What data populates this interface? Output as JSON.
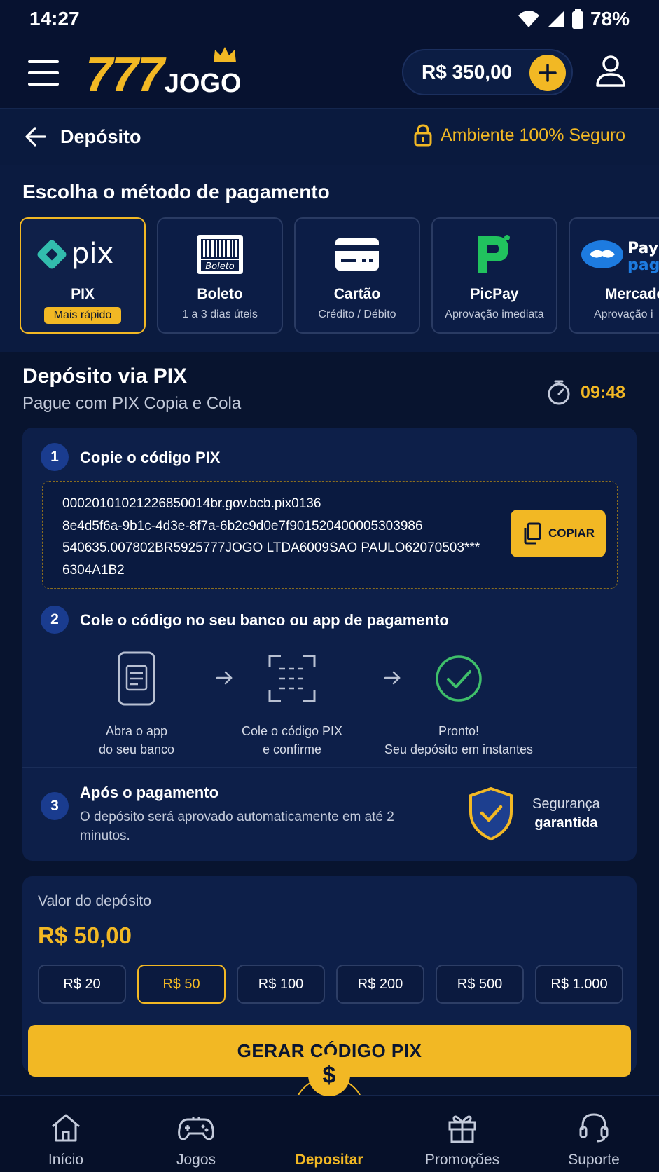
{
  "status_bar": {
    "time": "14:27",
    "battery": "78%"
  },
  "header": {
    "logo_number": "777",
    "logo_text": "JOGO",
    "balance": "R$ 350,00"
  },
  "subheader": {
    "title": "Depósito",
    "secure_text": "Ambiente 100% Seguro"
  },
  "methods": {
    "title": "Escolha o método de pagamento",
    "items": [
      {
        "name": "PIX",
        "sub": "Mais rápido",
        "active": true
      },
      {
        "name": "Boleto",
        "sub": "1 a 3 dias úteis",
        "active": false
      },
      {
        "name": "Cartão",
        "sub": "Crédito / Débito",
        "active": false
      },
      {
        "name": "PicPay",
        "sub": "Aprovação imediata",
        "active": false
      },
      {
        "name": "Mercado",
        "sub": "Aprovação i",
        "active": false
      }
    ],
    "pix_logo_text": "pix",
    "boleto_logo_text": "Boleto",
    "mercado_logo_text_1": "Pay",
    "mercado_logo_text_2": "pag"
  },
  "pix": {
    "title": "Depósito via PIX",
    "subtitle": "Pague com PIX Copia e Cola",
    "timer": "09:48",
    "step1": {
      "num": "1",
      "title": "Copie o código PIX"
    },
    "code": "00020101021226850014br.gov.bcb.pix0136 8e4d5f6a-9b1c-4d3e-8f7a-6b2c9d0e7f901520400005303986 540635.007802BR5925777JOGO LTDA6009SAO PAULO62070503*** 6304A1B2",
    "code_lines": [
      "00020101021226850014br.gov.bcb.pix0136",
      "8e4d5f6a-9b1c-4d3e-8f7a-6b2c9d0e7f901520400005303986",
      "540635.007802BR5925777JOGO LTDA6009SAO PAULO62070503***",
      "6304A1B2"
    ],
    "copy_label": "COPIAR",
    "step2": {
      "num": "2",
      "title": "Cole o código no seu banco ou app de pagamento"
    },
    "flow": [
      {
        "line1": "Abra o app",
        "line2": "do seu banco"
      },
      {
        "line1": "Cole o código PIX",
        "line2": "e confirme"
      },
      {
        "line1": "Pronto!",
        "line2": "Seu depósito em instantes"
      }
    ],
    "step3": {
      "num": "3",
      "title": "Após o pagamento",
      "text": "O depósito será aprovado automaticamente em até 2 minutos."
    },
    "guarantee_line1": "Segurança",
    "guarantee_line2": "garantida"
  },
  "deposit": {
    "label": "Valor do depósito",
    "value": "R$ 50,00",
    "chips": [
      {
        "label": "R$ 20",
        "active": false
      },
      {
        "label": "R$ 50",
        "active": true
      },
      {
        "label": "R$ 100",
        "active": false
      },
      {
        "label": "R$ 200",
        "active": false
      },
      {
        "label": "R$ 500",
        "active": false
      },
      {
        "label": "R$ 1.000",
        "active": false
      }
    ],
    "button": "GERAR CÓDIGO PIX"
  },
  "nav": {
    "items": [
      {
        "label": "Início",
        "icon": "home-icon"
      },
      {
        "label": "Jogos",
        "icon": "gamepad-icon"
      },
      {
        "label": "Depositar",
        "icon": "dollar-icon",
        "active": true
      },
      {
        "label": "Promoções",
        "icon": "gift-icon"
      },
      {
        "label": "Suporte",
        "icon": "headset-icon"
      }
    ],
    "deposit_symbol": "$"
  },
  "colors": {
    "background": "#08142f",
    "accent": "#f2b824",
    "card": "#0d1f49",
    "step_badge": "#1a3c8f",
    "success": "#3fbf6a",
    "pix_teal": "#32bcad",
    "picpay": "#21c25e",
    "mercado": "#1d7be0"
  }
}
